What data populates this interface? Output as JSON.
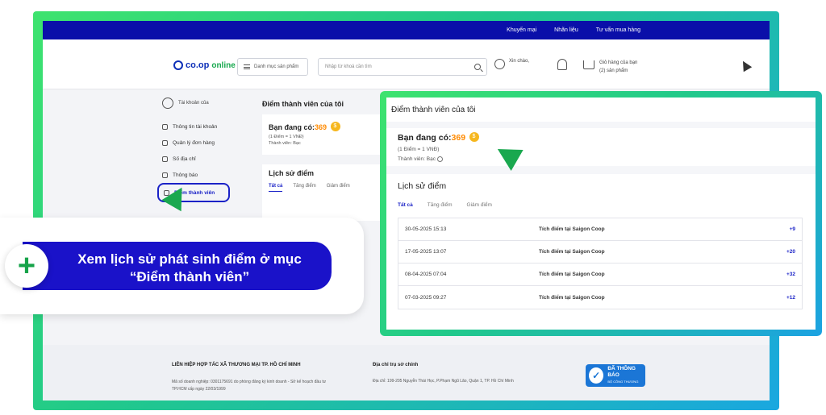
{
  "topbar": {
    "links": [
      "Khuyến mại",
      "Nhãn liệu",
      "Tư vấn mua hàng"
    ]
  },
  "header": {
    "logo_main": "co.op",
    "logo_sub": "online",
    "category_button": "Danh mục sản phẩm",
    "search_placeholder": "Nhập từ khoá cần tìm",
    "greeting": "Xin chào,",
    "cart_line1": "Giỏ hàng của bạn",
    "cart_line2": "(2) sản phẩm"
  },
  "sidebar": {
    "account_label": "Tài khoản của",
    "items": [
      "Thông tin tài khoản",
      "Quản lý đơn hàng",
      "Số địa chỉ",
      "Thông báo",
      "Điểm thành viên"
    ]
  },
  "member_card": {
    "title": "Điểm thành viên của tôi",
    "balance_label": "Bạn đang có:",
    "balance_value": "369",
    "coin_symbol": "$",
    "rate": "(1 Điểm = 1 VNĐ)",
    "tier": "Thành viên: Bạc"
  },
  "history": {
    "title": "Lịch sử điểm",
    "tabs": [
      "Tất cả",
      "Tăng điểm",
      "Giảm điểm"
    ],
    "rows": [
      {
        "date": "30-05-2025 15:13",
        "desc": "Tích điểm tại Saigon Coop",
        "points": "+9"
      },
      {
        "date": "17-05-2025 13:07",
        "desc": "Tích điểm tại Saigon Coop",
        "points": "+20"
      },
      {
        "date": "08-04-2025 07:04",
        "desc": "Tích điểm tại Saigon Coop",
        "points": "+32"
      },
      {
        "date": "07-03-2025 09:27",
        "desc": "Tích điểm tại Saigon Coop",
        "points": "+12"
      }
    ]
  },
  "footer": {
    "org": "LIÊN HIỆP HỢP TÁC XÃ THƯƠNG MẠI TP. HỒ CHÍ MINH",
    "org_desc_1": "Mã số doanh nghiệp: 0301175691 do phòng đăng ký kinh doanh - Sở kế hoạch đầu tư",
    "org_desc_2": "TP.HCM cấp ngày 22/03/1999",
    "address_title": "Địa chỉ trụ sở chính",
    "address": "Địa chỉ: 199-205 Nguyễn Thái Học, P.Phạm Ngũ Lão, Quận 1, TP. Hồ Chí Minh",
    "badge_text": "ĐÃ THÔNG BÁO",
    "badge_sub": "BỘ CÔNG THƯƠNG"
  },
  "banner": {
    "line1": "Xem lịch sử phát sinh điểm ở mục",
    "line2": "“Điểm thành viên”",
    "plus": "+"
  },
  "colors": {
    "brand_blue": "#0a0fa9",
    "accent_green": "#1aa84f",
    "highlight": "#1a22c7",
    "gold": "#ff8a00"
  }
}
